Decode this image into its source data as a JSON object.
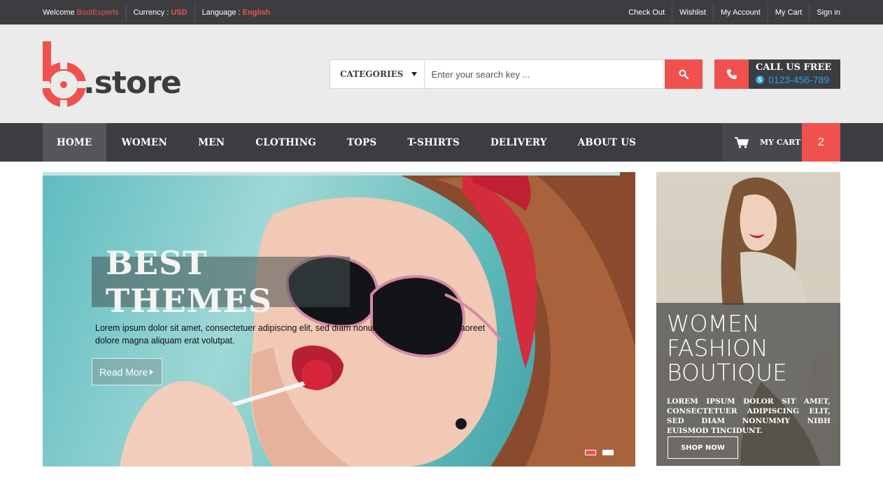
{
  "topbar": {
    "welcome_label": "Welcome",
    "welcome_user": "BootExperts",
    "currency_label": "Currency :",
    "currency_value": "USD",
    "language_label": "Language :",
    "language_value": "English",
    "links": [
      "Check Out",
      "Wishlist",
      "My Account",
      "My Cart",
      "Sign in"
    ]
  },
  "header": {
    "logo_text": ".store",
    "logo_letter": "b",
    "search": {
      "category_label": "CATEGORIES",
      "placeholder": "Enter your search key ..."
    },
    "call": {
      "title": "CALL US FREE",
      "phone": "0123-456-789"
    }
  },
  "nav": {
    "items": [
      "HOME",
      "WOMEN",
      "MEN",
      "CLOTHING",
      "TOPS",
      "T-SHIRTS",
      "DELIVERY",
      "ABOUT US"
    ],
    "active": "HOME",
    "cart_label": "MY CART",
    "cart_count": "2"
  },
  "hero": {
    "title": "BEST THEMES",
    "description": "Lorem ipsum dolor sit amet, consectetuer adipiscing elit, sed diam nonummy nibh euismod ut laoreet dolore magna aliquam erat volutpat.",
    "button": "Read More",
    "slides": 2,
    "active_slide": 1
  },
  "side_banner": {
    "title_lines": [
      "WOMEN",
      "FASHION",
      "BOUTIQUE"
    ],
    "text": "LOREM IPSUM DOLOR SIT AMET, CONSECTETUER ADIPISCING ELIT, SED DIAM NONUMMY NIBH EUISMOD TINCIDUNT.",
    "button": "SHOP NOW"
  },
  "colors": {
    "accent": "#f0514e",
    "dark": "#3c3d41",
    "header_bg": "#ebebeb",
    "phone_blue": "#2f9de0"
  }
}
